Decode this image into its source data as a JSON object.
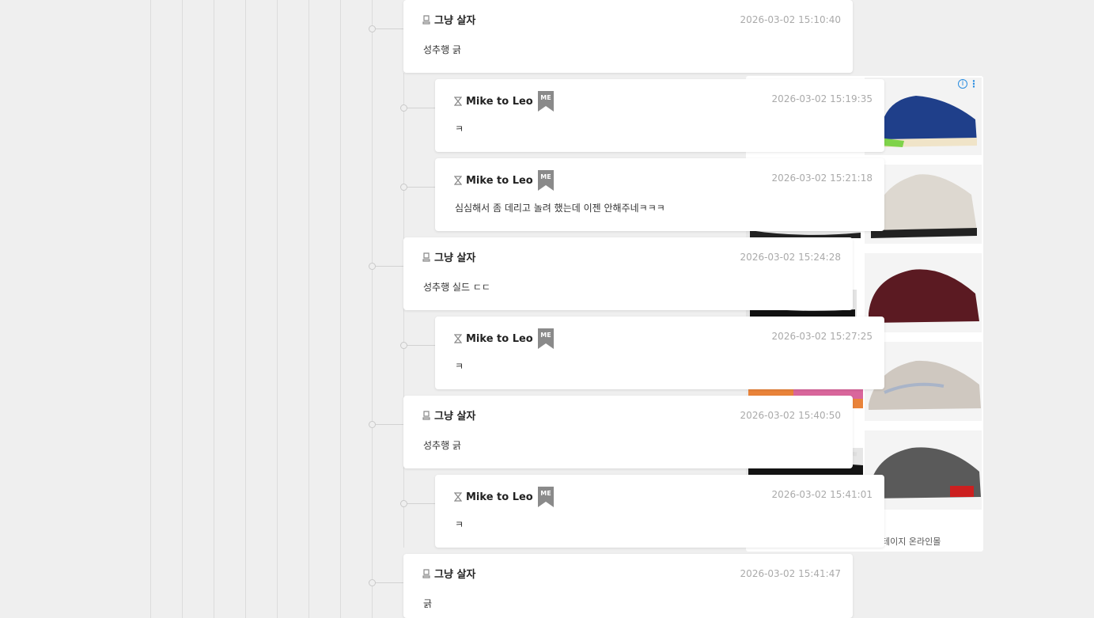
{
  "ad": {
    "caption": "테이지 온라인몰",
    "info_icon": "info-icon",
    "more_icon": "kebab-menu-icon"
  },
  "comments": [
    {
      "author": "그냥 살자",
      "time": "2026-03-02 15:10:40",
      "text": "성추행 긁",
      "me": false
    },
    {
      "author": "Mike to Leo",
      "time": "2026-03-02 15:19:35",
      "text": "ㅋ",
      "me": true
    },
    {
      "author": "Mike to Leo",
      "time": "2026-03-02 15:21:18",
      "text": "심심해서 좀 데리고 놀려 했는데 이젠 안해주네ㅋㅋㅋ",
      "me": true
    },
    {
      "author": "그냥 살자",
      "time": "2026-03-02 15:24:28",
      "text": "성추행 실드 ㄷㄷ",
      "me": false
    },
    {
      "author": "Mike to Leo",
      "time": "2026-03-02 15:27:25",
      "text": "ㅋ",
      "me": true
    },
    {
      "author": "그냥 살자",
      "time": "2026-03-02 15:40:50",
      "text": "성추행 긁",
      "me": false
    },
    {
      "author": "Mike to Leo",
      "time": "2026-03-02 15:41:01",
      "text": "ㅋ",
      "me": true
    },
    {
      "author": "그냥 살자",
      "time": "2026-03-02 15:41:47",
      "text": "긁",
      "me": false
    }
  ],
  "me_badge_label": "ME",
  "colors": {
    "background": "#efefef",
    "card": "#ffffff",
    "badge": "#8a8a8a",
    "time": "#aaaaaa"
  }
}
